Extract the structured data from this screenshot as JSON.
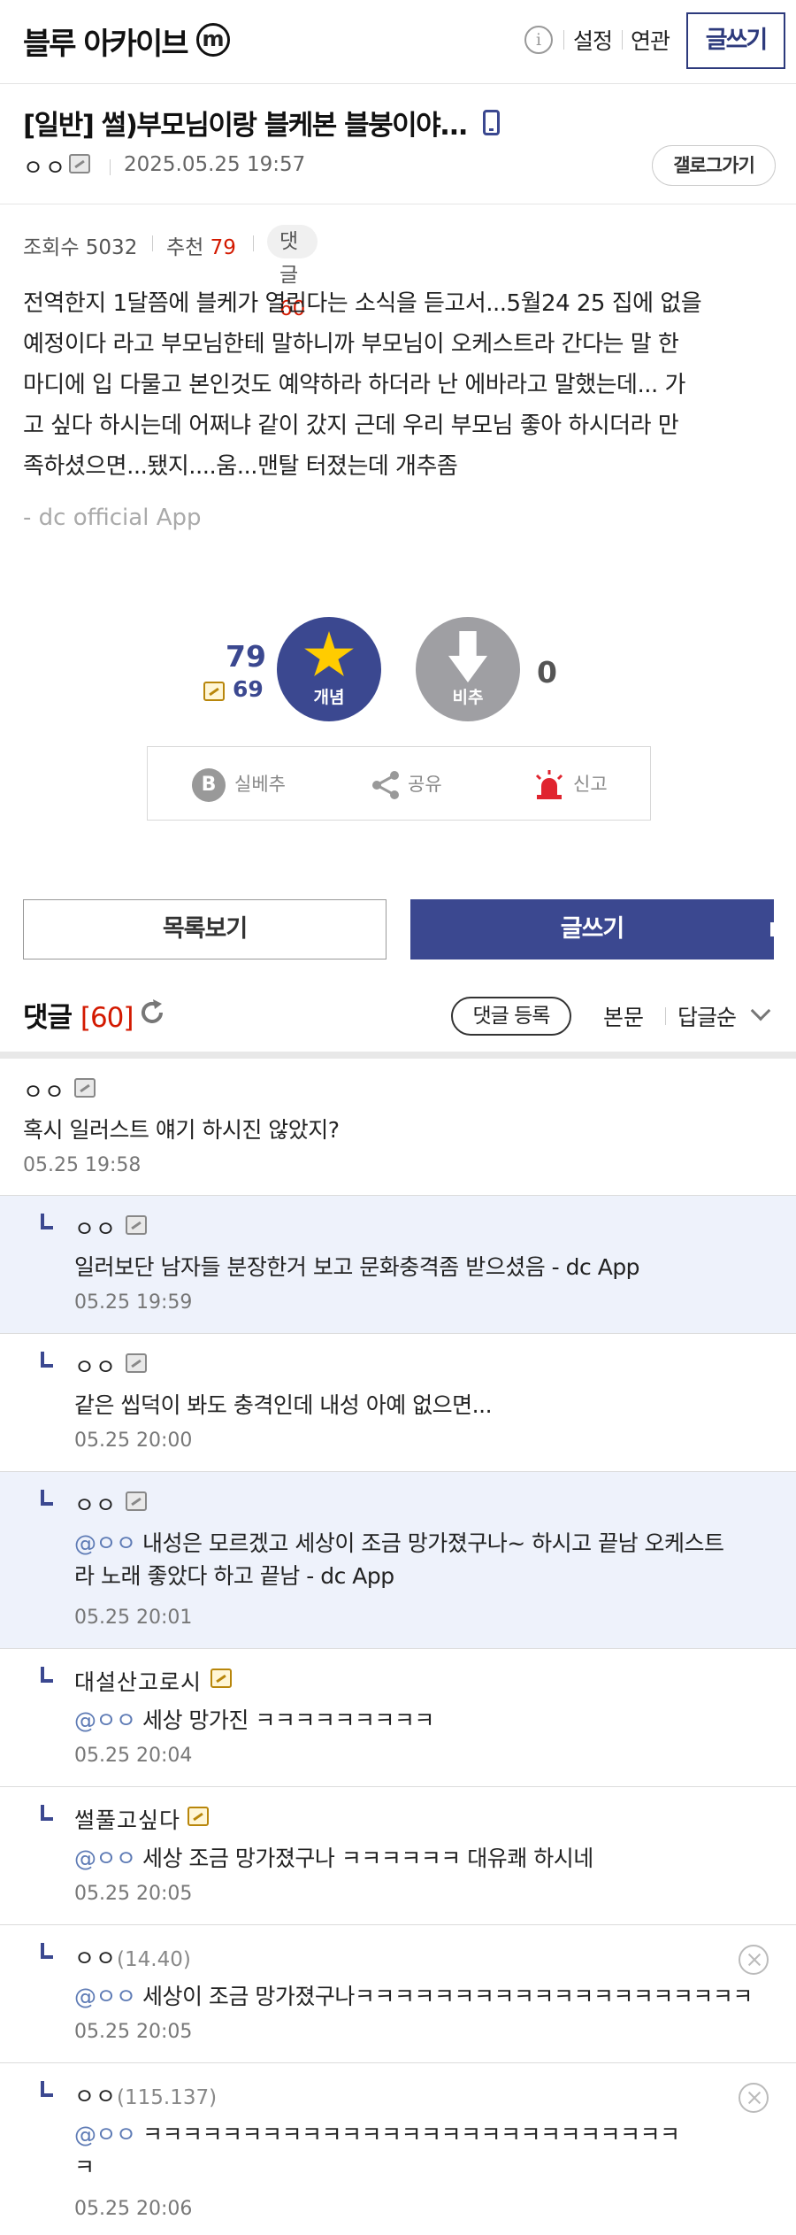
{
  "header": {
    "gallery_name": "블루 아카이브",
    "mini_badge": "m",
    "info_icon": "i",
    "links": [
      "설정",
      "연관"
    ],
    "write_label": "글쓰기"
  },
  "post": {
    "title": "[일반] 썰)부모님이랑 블케본 블붕이야...",
    "author": "ㅇㅇ",
    "date": "2025.05.25 19:57",
    "gallery_button": "갤로그가기",
    "views": "조회수 5032",
    "recommend_label": "추천",
    "recommend_value": "79",
    "comment_label": "댓글",
    "comment_value": "60",
    "body_lines": [
      "전역한지 1달쯤에 블케가 열린다는 소식을 듣고서...5월24 25 집에 없을",
      "예정이다 라고 부모님한테 말하니까 부모님이 오케스트라 간다는 말 한",
      "마디에 입 다물고 본인것도 예약하라 하더라 난 에바라고 말했는데... 가",
      "고 싶다 하시는데 어쩌냐 같이 갔지 근데 우리 부모님 좋아 하시더라 만",
      "족하셨으면...됐지....움...맨탈 터졌는데 개추좀"
    ],
    "signature": "- dc official App"
  },
  "vote": {
    "recommend_count": "79",
    "fixed_recommend_count": "69",
    "recommend_label": "개념",
    "unrecommend_label": "비추",
    "unrecommend_count": "0"
  },
  "actions": {
    "best_label": "실베추",
    "share_label": "공유",
    "report_label": "신고"
  },
  "buttons": {
    "list_label": "목록보기",
    "write_label": "글쓰기"
  },
  "comments_header": {
    "title": "댓글",
    "count": "[60]",
    "register_label": "댓글 등록",
    "body_label": "본문",
    "sort_label": "답글순"
  },
  "comments": [
    {
      "nick": "ㅇㅇ",
      "ip": "",
      "mention": "",
      "text": "혹시 일러스트 얘기 하시진 않았지?",
      "text2": "",
      "date": "05.25 19:58"
    },
    {
      "nick": "ㅇㅇ",
      "ip": "",
      "mention": "",
      "text": "일러보단 남자들 분장한거 보고 문화충격좀 받으셨음 - dc App",
      "text2": "",
      "date": "05.25 19:59"
    },
    {
      "nick": "ㅇㅇ",
      "ip": "",
      "mention": "",
      "text": "같은 씹덕이 봐도 충격인데 내성 아예 없으면...",
      "text2": "",
      "date": "05.25 20:00"
    },
    {
      "nick": "ㅇㅇ",
      "ip": "",
      "mention": "@ㅇㅇ",
      "text": " 내성은 모르겠고 세상이 조금 망가졌구나~ 하시고 끝남 오케스트",
      "text2": "라 노래 좋았다 하고 끝남 - dc App",
      "date": "05.25 20:01"
    },
    {
      "nick": "대설산고로시",
      "ip": "",
      "mention": "@ㅇㅇ",
      "text": " 세상 망가진 ㅋㅋㅋㅋㅋㅋㅋㅋㅋ",
      "text2": "",
      "date": "05.25 20:04"
    },
    {
      "nick": "썰풀고싶다",
      "ip": "",
      "mention": "@ㅇㅇ",
      "text": " 세상 조금 망가졌구나 ㅋㅋㅋㅋㅋㅋ 대유쾌 하시네",
      "text2": "",
      "date": "05.25 20:05"
    },
    {
      "nick": "ㅇㅇ",
      "ip": "(14.40)",
      "mention": "@ㅇㅇ",
      "text": " 세상이 조금 망가졌구나ㅋㅋㅋㅋㅋㅋㅋㅋㅋㅋㅋㅋㅋㅋㅋㅋㅋㅋㅋㅋ",
      "text2": "",
      "date": "05.25 20:05"
    },
    {
      "nick": "ㅇㅇ",
      "ip": "(115.137)",
      "mention": "@ㅇㅇ",
      "text": " ㅋㅋㅋㅋㅋㅋㅋㅋㅋㅋㅋㅋㅋㅋㅋㅋㅋㅋㅋㅋㅋㅋㅋㅋㅋㅋㅋ",
      "text2": "ㅋ",
      "date": "05.25 20:06"
    }
  ],
  "colors": {
    "brand": "#3b4890",
    "count_red": "#d31900",
    "mention": "#5e7bb5",
    "reply_highlight": "#eef2fb"
  }
}
